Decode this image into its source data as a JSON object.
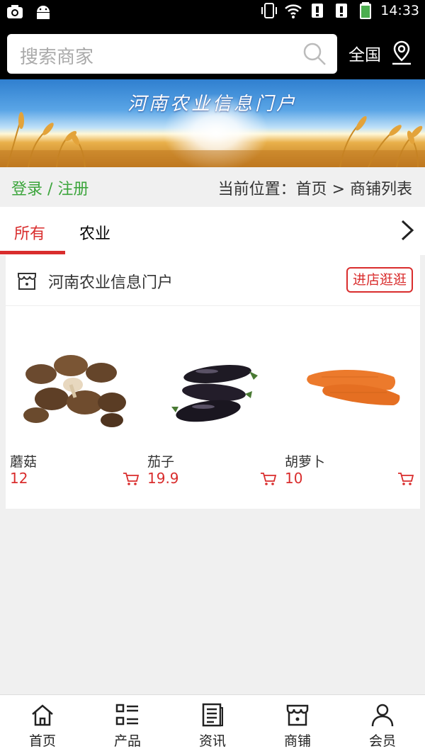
{
  "status_bar": {
    "time": "14:33"
  },
  "header": {
    "search_placeholder": "搜索商家",
    "region_label": "全国"
  },
  "banner": {
    "title": "河南农业信息门户"
  },
  "breadcrumb": {
    "login_label": "登录",
    "separator": " / ",
    "register_label": "注册",
    "location_text": "当前位置：首页 > 商铺列表"
  },
  "tabs": [
    {
      "label": "所有",
      "active": true
    },
    {
      "label": "农业",
      "active": false
    }
  ],
  "shop": {
    "name": "河南农业信息门户",
    "visit_button": "进店逛逛",
    "products": [
      {
        "name": "蘑菇",
        "price": "12",
        "image": "mushrooms"
      },
      {
        "name": "茄子",
        "price": "19.9",
        "image": "eggplants"
      },
      {
        "name": "胡萝卜",
        "price": "10",
        "image": "carrots"
      }
    ]
  },
  "bottom_nav": [
    {
      "label": "首页",
      "icon": "home-icon"
    },
    {
      "label": "产品",
      "icon": "list-icon"
    },
    {
      "label": "资讯",
      "icon": "news-icon"
    },
    {
      "label": "商铺",
      "icon": "shop-icon"
    },
    {
      "label": "会员",
      "icon": "user-icon"
    }
  ],
  "colors": {
    "accent": "#d92d2d",
    "login_green": "#3ca53c"
  }
}
